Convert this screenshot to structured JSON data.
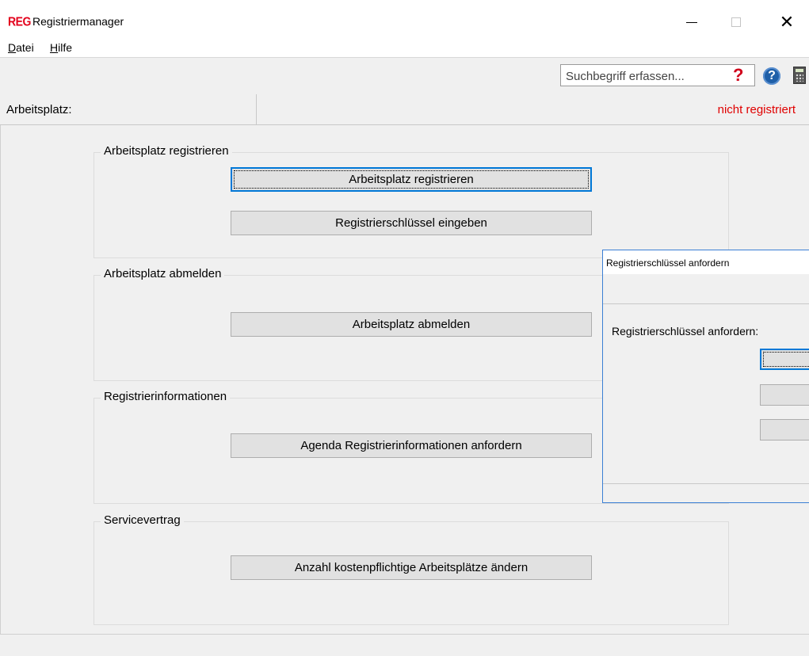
{
  "window": {
    "logo_text": "REG",
    "title": "Registriermanager",
    "minimize_glyph": "—",
    "maximize_glyph": "□",
    "close_glyph": "✕"
  },
  "menu": {
    "items": [
      {
        "accel": "D",
        "rest": "atei"
      },
      {
        "accel": "H",
        "rest": "ilfe"
      }
    ]
  },
  "toolbar": {
    "search_placeholder": "Suchbegriff erfassen...",
    "help_glyph": "?",
    "info_glyph": "?"
  },
  "status": {
    "label": "Arbeitsplatz:",
    "value": "nicht registriert",
    "value_color": "#e00000"
  },
  "groups": [
    {
      "title": "Arbeitsplatz registrieren",
      "buttons": [
        "Arbeitsplatz registrieren",
        "Registrierschlüssel eingeben"
      ]
    },
    {
      "title": "Arbeitsplatz abmelden",
      "buttons": [
        "Arbeitsplatz abmelden"
      ]
    },
    {
      "title": "Registrierinformationen",
      "buttons": [
        "Agenda Registrierinformationen anfordern"
      ]
    },
    {
      "title": "Servicevertrag",
      "buttons": [
        "Anzahl kostenpflichtige Arbeitsplätze ändern"
      ]
    }
  ],
  "dialog": {
    "title": "Registrierschlüssel anfordern",
    "label": "Registrierschlüssel anfordern:"
  },
  "colors": {
    "accent": "#0078d7",
    "logo": "#e3001b",
    "help": "#d0021b"
  },
  "icons": {
    "help": "red-question-icon",
    "info": "blue-help-circle-icon",
    "calculator": "calculator-icon"
  }
}
